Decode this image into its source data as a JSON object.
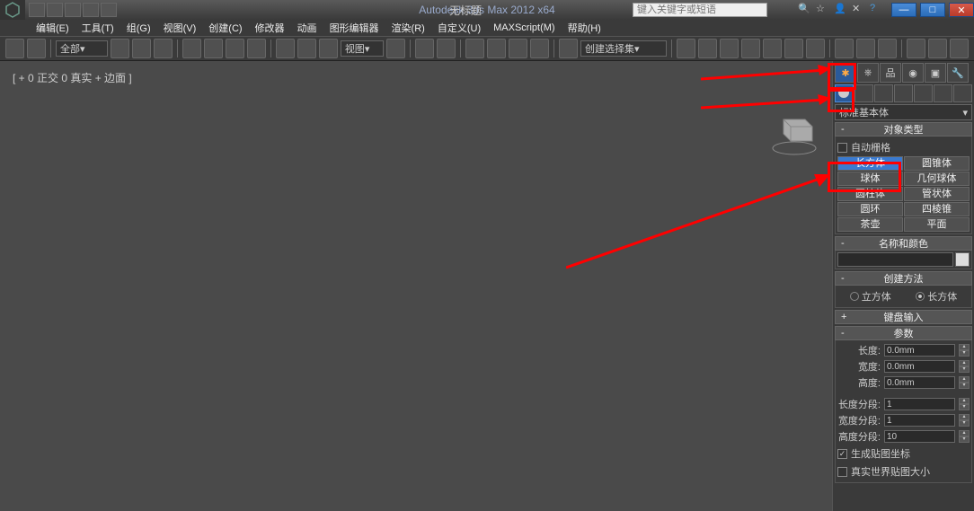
{
  "titlebar": {
    "app_title": "Autodesk 3ds Max  2012 x64",
    "document": "无标题",
    "search_placeholder": "键入关键字或短语"
  },
  "menus": [
    "编辑(E)",
    "工具(T)",
    "组(G)",
    "视图(V)",
    "创建(C)",
    "修改器",
    "动画",
    "图形编辑器",
    "渲染(R)",
    "自定义(U)",
    "MAXScript(M)",
    "帮助(H)"
  ],
  "toolbar": {
    "sel_set": "全部",
    "view": "视图",
    "named_sel": "创建选择集"
  },
  "viewport": {
    "label": "[ + 0 正交 0 真实 + 边面 ]"
  },
  "panel": {
    "category": "标准基本体",
    "rollouts": {
      "object_type": {
        "title": "对象类型",
        "auto_grid": "自动栅格"
      },
      "name_color": {
        "title": "名称和颜色"
      },
      "creation": {
        "title": "创建方法",
        "cube": "立方体",
        "box": "长方体"
      },
      "keyboard": {
        "title": "键盘输入"
      },
      "params": {
        "title": "参数"
      }
    },
    "objects": [
      [
        "长方体",
        "圆锥体"
      ],
      [
        "球体",
        "几何球体"
      ],
      [
        "圆柱体",
        "管状体"
      ],
      [
        "圆环",
        "四棱锥"
      ],
      [
        "茶壶",
        "平面"
      ]
    ],
    "params": {
      "length": {
        "label": "长度:",
        "value": "0.0mm"
      },
      "width": {
        "label": "宽度:",
        "value": "0.0mm"
      },
      "height": {
        "label": "高度:",
        "value": "0.0mm"
      },
      "lsegs": {
        "label": "长度分段:",
        "value": "1"
      },
      "wsegs": {
        "label": "宽度分段:",
        "value": "1"
      },
      "hsegs": {
        "label": "高度分段:",
        "value": "10"
      },
      "gen_map": "生成贴图坐标",
      "real_world": "真实世界贴图大小"
    }
  }
}
